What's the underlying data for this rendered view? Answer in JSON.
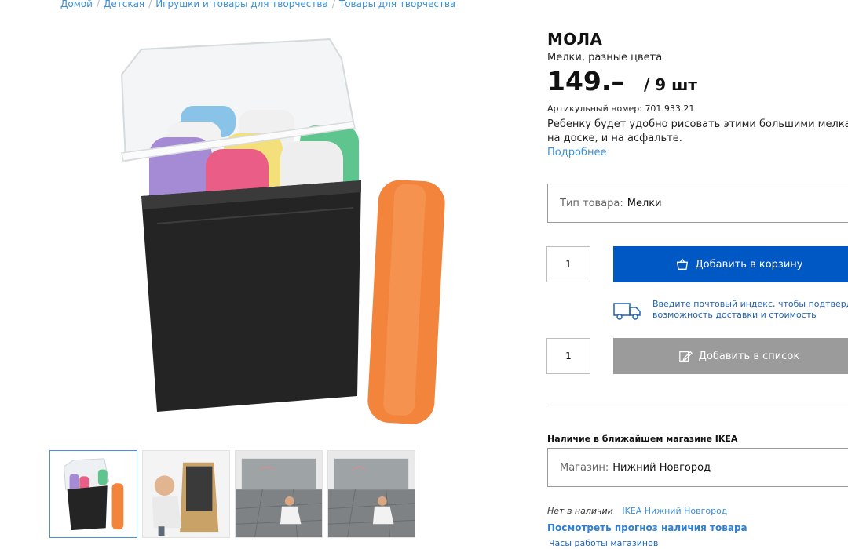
{
  "breadcrumb": [
    "Домой",
    "Детская",
    "Игрушки и товары для творчества",
    "Товары для творчества"
  ],
  "product": {
    "name": "МОЛА",
    "subtitle": "Мелки, разные цвета",
    "price": "149.–",
    "unit": "/ 9 шт",
    "article_label": "Артикульный номер:",
    "article_number": "701.933.21",
    "description_line1": "Ребенку будет удобно рисовать этими большими мелками",
    "description_line2": "на доске, и на асфальте.",
    "more_link": "Подробнее"
  },
  "type_select": {
    "label": "Тип товара:",
    "value": "Мелки"
  },
  "cart": {
    "quantity": "1",
    "button": "Добавить в корзину"
  },
  "delivery": {
    "line1": "Введите почтовый индекс, чтобы подтвердить",
    "line2": "возможность доставки и стоимость"
  },
  "list": {
    "quantity": "1",
    "button": "Добавить в список"
  },
  "availability": {
    "title": "Наличие в ближайшем магазине IKEA",
    "store_label": "Магазин:",
    "store_value": "Нижний Новгород",
    "status": "Нет в наличии",
    "store_link": "IKEA Нижний Новгород",
    "forecast_link": "Посмотреть прогноз наличия товара",
    "hours_link": "Часы работы магазинов"
  },
  "colors": {
    "accent": "#0058c4",
    "link": "#3b8fd9",
    "disabled": "#9b9b9b"
  }
}
